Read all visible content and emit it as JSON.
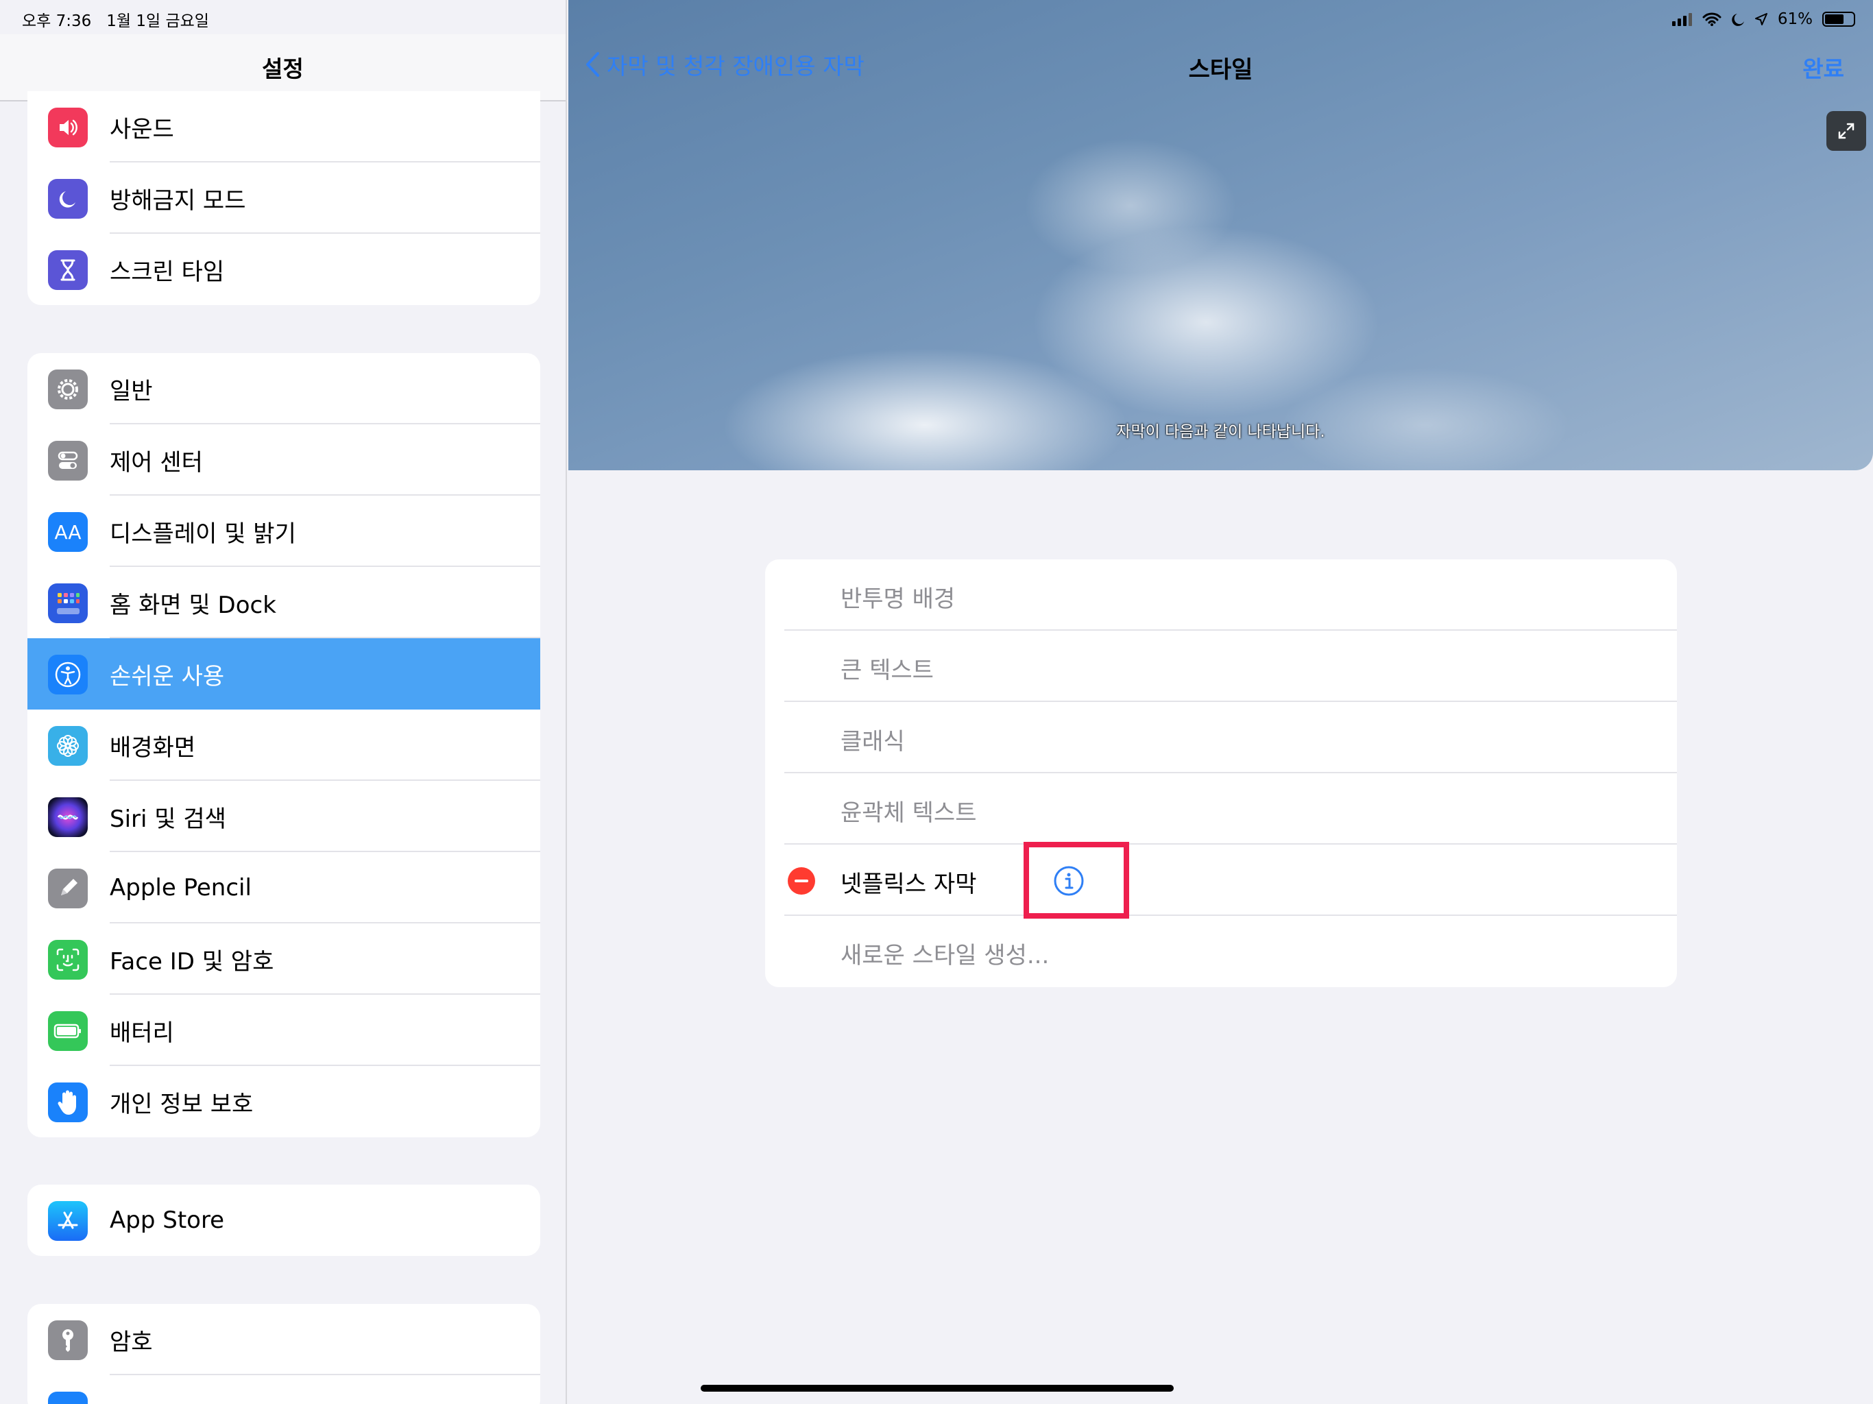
{
  "status_bar": {
    "time": "오후 7:36",
    "date": "1월 1일 금요일",
    "battery": "61%"
  },
  "sidebar": {
    "title": "설정",
    "groups": [
      {
        "items": [
          {
            "label": "사운드",
            "icon": "speaker-icon",
            "color": "#f2395b"
          },
          {
            "label": "방해금지 모드",
            "icon": "moon-icon",
            "color": "#5b55d6"
          },
          {
            "label": "스크린 타임",
            "icon": "hourglass-icon",
            "color": "#5b55d6"
          }
        ]
      },
      {
        "items": [
          {
            "label": "일반",
            "icon": "gear-icon",
            "color": "#8e8e93"
          },
          {
            "label": "제어 센터",
            "icon": "toggles-icon",
            "color": "#8e8e93"
          },
          {
            "label": "디스플레이 및 밝기",
            "icon": "text-size-icon",
            "color": "#1a82fb"
          },
          {
            "label": "홈 화면 및 Dock",
            "icon": "home-grid-icon",
            "color": "#2c5be0"
          },
          {
            "label": "손쉬운 사용",
            "icon": "accessibility-icon",
            "color": "#1a82fb"
          },
          {
            "label": "배경화면",
            "icon": "flower-icon",
            "color": "#38b0e8"
          },
          {
            "label": "Siri 및 검색",
            "icon": "siri-icon",
            "color": "#222"
          },
          {
            "label": "Apple Pencil",
            "icon": "pencil-icon",
            "color": "#8e8e93"
          },
          {
            "label": "Face ID 및 암호",
            "icon": "face-id-icon",
            "color": "#34c759"
          },
          {
            "label": "배터리",
            "icon": "battery-icon",
            "color": "#34c759"
          },
          {
            "label": "개인 정보 보호",
            "icon": "hand-icon",
            "color": "#1a82fb"
          }
        ]
      },
      {
        "items": [
          {
            "label": "App Store",
            "icon": "app-store-icon",
            "color": "#1a8cf5"
          }
        ]
      },
      {
        "items": [
          {
            "label": "암호",
            "icon": "key-icon",
            "color": "#8e8e93"
          },
          {
            "label": "",
            "icon": "mail-icon",
            "color": "#1a82fb"
          }
        ]
      }
    ],
    "selected": "손쉬운 사용"
  },
  "detail": {
    "back_label": "자막 및 청각 장애인용 자막",
    "title": "스타일",
    "done_label": "완료",
    "preview_caption": "자막이 다음과 같이 나타납니다.",
    "styles": [
      {
        "label": "반투명 배경",
        "editable": false
      },
      {
        "label": "큰 텍스트",
        "editable": false
      },
      {
        "label": "클래식",
        "editable": false
      },
      {
        "label": "윤곽체 텍스트",
        "editable": false
      },
      {
        "label": "넷플릭스 자막",
        "editable": true
      },
      {
        "label": "새로운 스타일 생성...",
        "editable": false
      }
    ]
  }
}
